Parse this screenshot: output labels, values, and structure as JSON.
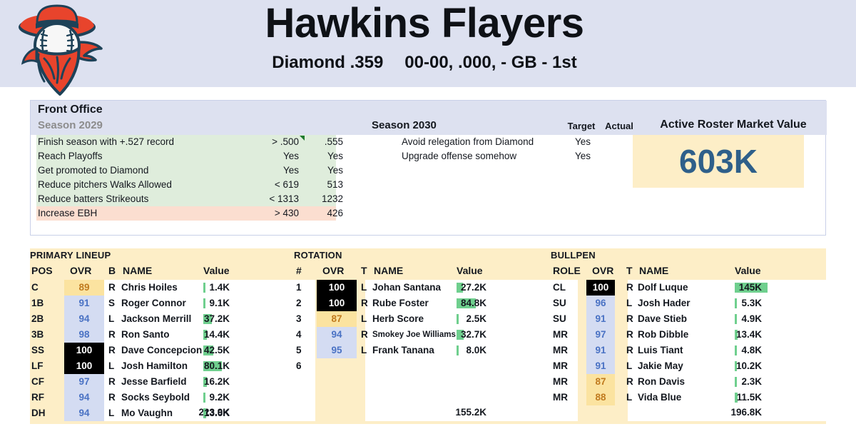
{
  "header": {
    "team_name": "Hawkins Flayers",
    "league": "Diamond .359",
    "record": "00-00, .000, - GB - 1st",
    "logo_icon": "cowboy-baseball-logo"
  },
  "front_office": {
    "title": "Front Office",
    "left_season_label": "Season 2029",
    "right_season_label": "Season 2030",
    "col_target": "Target",
    "col_actual": "Actual",
    "market_value_label": "Active Roster Market Value",
    "market_value": "603K",
    "goals_2029": [
      {
        "name": "Finish season with +.527 record",
        "target": "> .500",
        "actual": ".555",
        "met": true,
        "flag": true
      },
      {
        "name": "Reach Playoffs",
        "target": "Yes",
        "actual": "Yes",
        "met": true,
        "flag": false
      },
      {
        "name": "Get promoted to Diamond",
        "target": "Yes",
        "actual": "Yes",
        "met": true,
        "flag": false
      },
      {
        "name": "Reduce pitchers Walks Allowed",
        "target": "< 619",
        "actual": "513",
        "met": true,
        "flag": false
      },
      {
        "name": "Reduce batters Strikeouts",
        "target": "< 1313",
        "actual": "1232",
        "met": true,
        "flag": false
      },
      {
        "name": "Increase EBH",
        "target": "> 430",
        "actual": "426",
        "met": false,
        "flag": false
      }
    ],
    "goals_2030": [
      {
        "name": "Avoid relegation from Diamond",
        "target": "Yes",
        "actual": ""
      },
      {
        "name": "Upgrade offense somehow",
        "target": "Yes",
        "actual": ""
      }
    ]
  },
  "lineup": {
    "title": "PRIMARY LINEUP",
    "headers": {
      "pos": "POS",
      "ovr": "OVR",
      "bats": "B",
      "name": "NAME",
      "value": "Value"
    },
    "total": "223.9K",
    "rows": [
      {
        "pos": "C",
        "ovr": "89",
        "tier": "mid",
        "bats": "R",
        "name": "Chris Hoiles",
        "value": "1.4K",
        "bar": 1.4
      },
      {
        "pos": "1B",
        "ovr": "91",
        "tier": "good",
        "bats": "S",
        "name": "Roger Connor",
        "value": "9.1K",
        "bar": 9.1
      },
      {
        "pos": "2B",
        "ovr": "94",
        "tier": "good",
        "bats": "L",
        "name": "Jackson Merrill",
        "value": "37.2K",
        "bar": 37.2
      },
      {
        "pos": "3B",
        "ovr": "98",
        "tier": "good",
        "bats": "R",
        "name": "Ron Santo",
        "value": "14.4K",
        "bar": 14.4
      },
      {
        "pos": "SS",
        "ovr": "100",
        "tier": "elite",
        "bats": "R",
        "name": "Dave Concepcion",
        "value": "42.5K",
        "bar": 42.5
      },
      {
        "pos": "LF",
        "ovr": "100",
        "tier": "elite",
        "bats": "L",
        "name": "Josh Hamilton",
        "value": "80.1K",
        "bar": 80.1
      },
      {
        "pos": "CF",
        "ovr": "97",
        "tier": "good",
        "bats": "R",
        "name": "Jesse Barfield",
        "value": "16.2K",
        "bar": 16.2
      },
      {
        "pos": "RF",
        "ovr": "94",
        "tier": "good",
        "bats": "R",
        "name": "Socks Seybold",
        "value": "9.2K",
        "bar": 9.2
      },
      {
        "pos": "DH",
        "ovr": "94",
        "tier": "good",
        "bats": "L",
        "name": "Mo Vaughn",
        "value": "13.6K",
        "bar": 13.6
      }
    ]
  },
  "rotation": {
    "title": "ROTATION",
    "headers": {
      "num": "#",
      "ovr": "OVR",
      "throws": "T",
      "name": "NAME",
      "value": "Value"
    },
    "total": "155.2K",
    "rows": [
      {
        "num": "1",
        "ovr": "100",
        "tier": "elite",
        "throws": "L",
        "name": "Johan Santana",
        "value": "27.2K",
        "bar": 27.2,
        "small": false
      },
      {
        "num": "2",
        "ovr": "100",
        "tier": "elite",
        "throws": "R",
        "name": "Rube Foster",
        "value": "84.8K",
        "bar": 84.8,
        "small": false
      },
      {
        "num": "3",
        "ovr": "87",
        "tier": "mid",
        "throws": "L",
        "name": "Herb Score",
        "value": "2.5K",
        "bar": 2.5,
        "small": false
      },
      {
        "num": "4",
        "ovr": "94",
        "tier": "good",
        "throws": "R",
        "name": "Smokey Joe Williams",
        "value": "32.7K",
        "bar": 32.7,
        "small": true
      },
      {
        "num": "5",
        "ovr": "95",
        "tier": "good",
        "throws": "L",
        "name": "Frank Tanana",
        "value": "8.0K",
        "bar": 8.0,
        "small": false
      },
      {
        "num": "6",
        "ovr": "",
        "tier": "none",
        "throws": "",
        "name": "",
        "value": "",
        "bar": 0,
        "small": false
      }
    ]
  },
  "bullpen": {
    "title": "BULLPEN",
    "headers": {
      "role": "ROLE",
      "ovr": "OVR",
      "throws": "T",
      "name": "NAME",
      "value": "Value"
    },
    "total": "196.8K",
    "rows": [
      {
        "role": "CL",
        "ovr": "100",
        "tier": "elite",
        "throws": "R",
        "name": "Dolf Luque",
        "value": "145K",
        "bar": 145
      },
      {
        "role": "SU",
        "ovr": "96",
        "tier": "good",
        "throws": "L",
        "name": "Josh Hader",
        "value": "5.3K",
        "bar": 5.3
      },
      {
        "role": "SU",
        "ovr": "91",
        "tier": "good",
        "throws": "R",
        "name": "Dave Stieb",
        "value": "4.9K",
        "bar": 4.9
      },
      {
        "role": "MR",
        "ovr": "97",
        "tier": "good",
        "throws": "R",
        "name": "Rob Dibble",
        "value": "13.4K",
        "bar": 13.4
      },
      {
        "role": "MR",
        "ovr": "91",
        "tier": "good",
        "throws": "R",
        "name": "Luis Tiant",
        "value": "4.8K",
        "bar": 4.8
      },
      {
        "role": "MR",
        "ovr": "91",
        "tier": "good",
        "throws": "L",
        "name": "Jakie May",
        "value": "10.2K",
        "bar": 10.2
      },
      {
        "role": "MR",
        "ovr": "87",
        "tier": "mid",
        "throws": "R",
        "name": "Ron Davis",
        "value": "2.3K",
        "bar": 2.3
      },
      {
        "role": "MR",
        "ovr": "88",
        "tier": "mid",
        "throws": "L",
        "name": "Vida Blue",
        "value": "11.5K",
        "bar": 11.5
      }
    ]
  },
  "colors": {
    "header_band": "#dde1f0",
    "panel_cream": "#fdeec7",
    "goal_met": "#dfeddc",
    "goal_miss": "#fbded0",
    "bar_green": "#6fcf8e",
    "ovr_elite_bg": "#000000",
    "ovr_good_bg": "#d4dcf2",
    "ovr_mid_bg": "#fbe3a0",
    "market_value_text": "#2e5f8a",
    "logo_red": "#e8442c",
    "logo_navy": "#1e4258"
  }
}
